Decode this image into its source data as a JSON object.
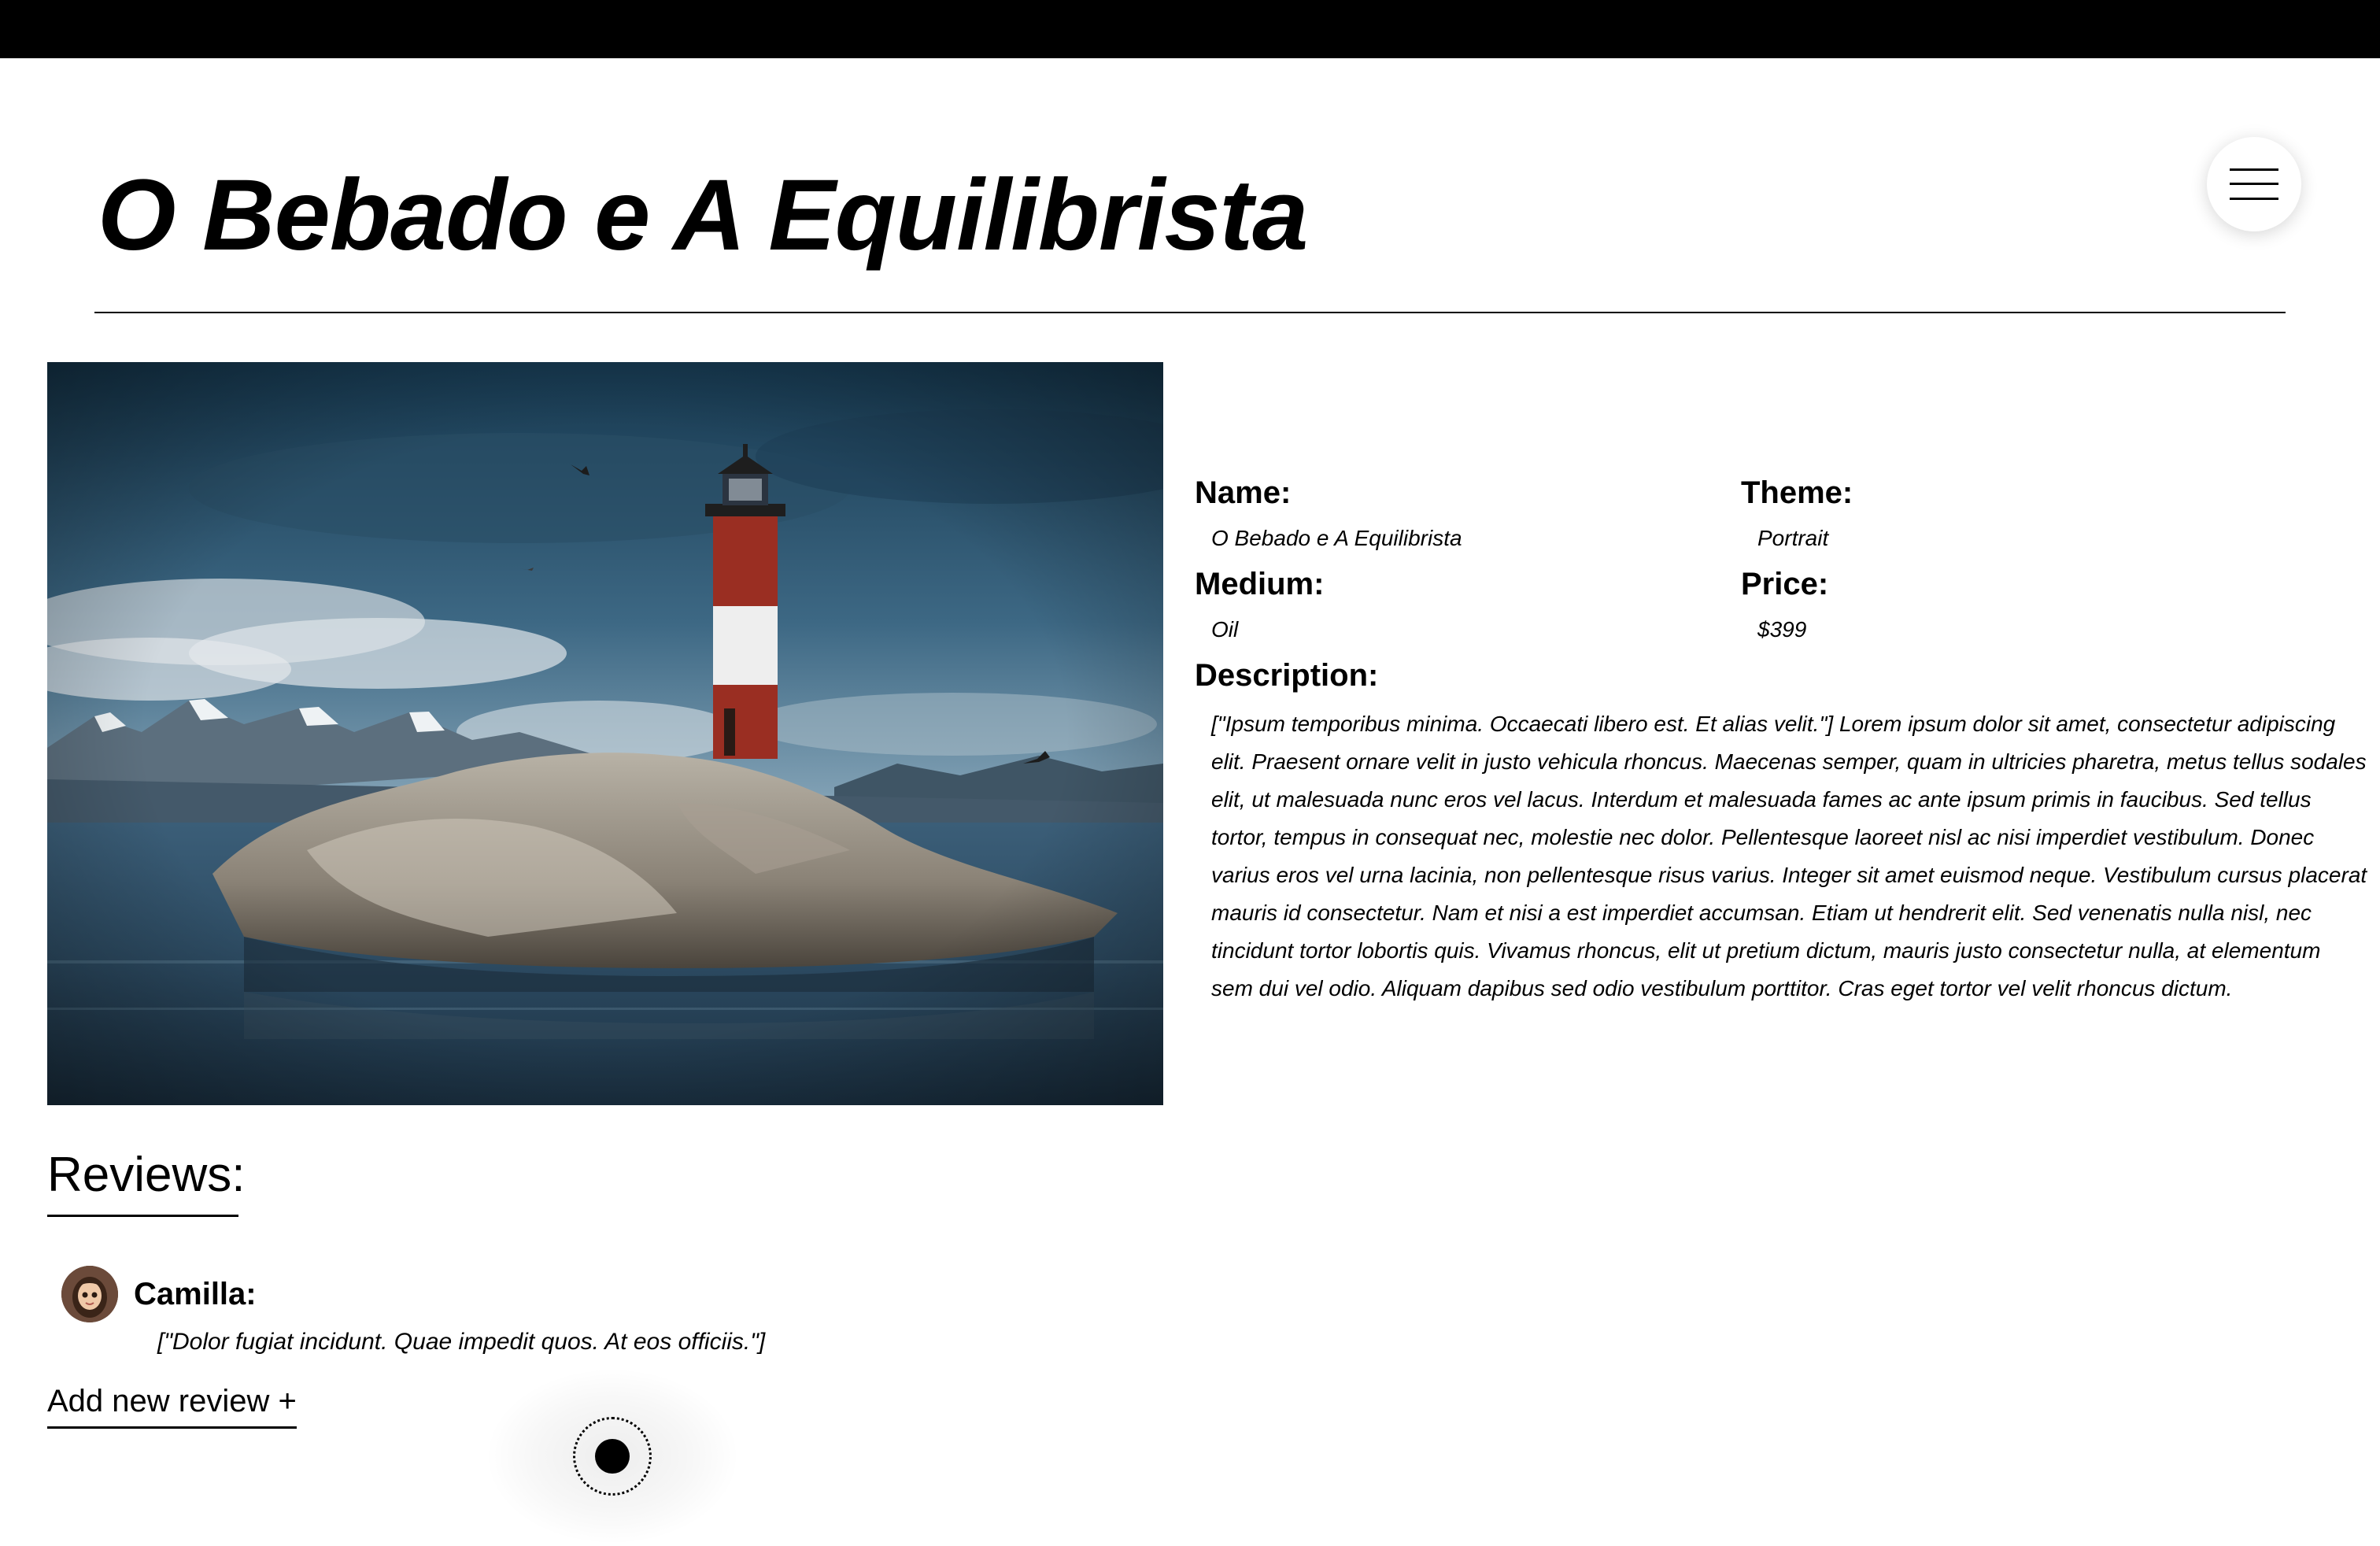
{
  "page": {
    "title": "O Bebado e A Equilibrista"
  },
  "menu": {
    "icon": "hamburger-menu-icon"
  },
  "artwork": {
    "image_subject": "lighthouse on rocky island",
    "details": {
      "name_label": "Name:",
      "name_value": "O Bebado e A Equilibrista",
      "theme_label": "Theme:",
      "theme_value": "Portrait",
      "medium_label": "Medium:",
      "medium_value": "Oil",
      "price_label": "Price:",
      "price_value": "$399",
      "description_label": "Description:",
      "description_text": "[\"Ipsum temporibus minima. Occaecati libero est. Et alias velit.\"] Lorem ipsum dolor sit amet, consectetur adipiscing elit. Praesent ornare velit in justo vehicula rhoncus. Maecenas semper, quam in ultricies pharetra, metus tellus sodales elit, ut malesuada nunc eros vel lacus. Interdum et malesuada fames ac ante ipsum primis in faucibus. Sed tellus tortor, tempus in consequat nec, molestie nec dolor. Pellentesque laoreet nisl ac nisi imperdiet vestibulum. Donec varius eros vel urna lacinia, non pellentesque risus varius. Integer sit amet euismod neque. Vestibulum cursus placerat mauris id consectetur. Nam et nisi a est imperdiet accumsan. Etiam ut hendrerit elit. Sed venenatis nulla nisl, nec tincidunt tortor lobortis quis. Vivamus rhoncus, elit ut pretium dictum, mauris justo consectetur nulla, at elementum sem dui vel odio. Aliquam dapibus sed odio vestibulum porttitor. Cras eget tortor vel velit rhoncus dictum."
    }
  },
  "reviews": {
    "heading": "Reviews:",
    "items": [
      {
        "author": "Camilla:",
        "text": "[\"Dolor fugiat incidunt. Quae impedit quos. At eos officiis.\"]"
      }
    ],
    "add_label": "Add new review +"
  },
  "colors": {
    "top_bar": "#000000",
    "background": "#ffffff",
    "text": "#000000"
  }
}
